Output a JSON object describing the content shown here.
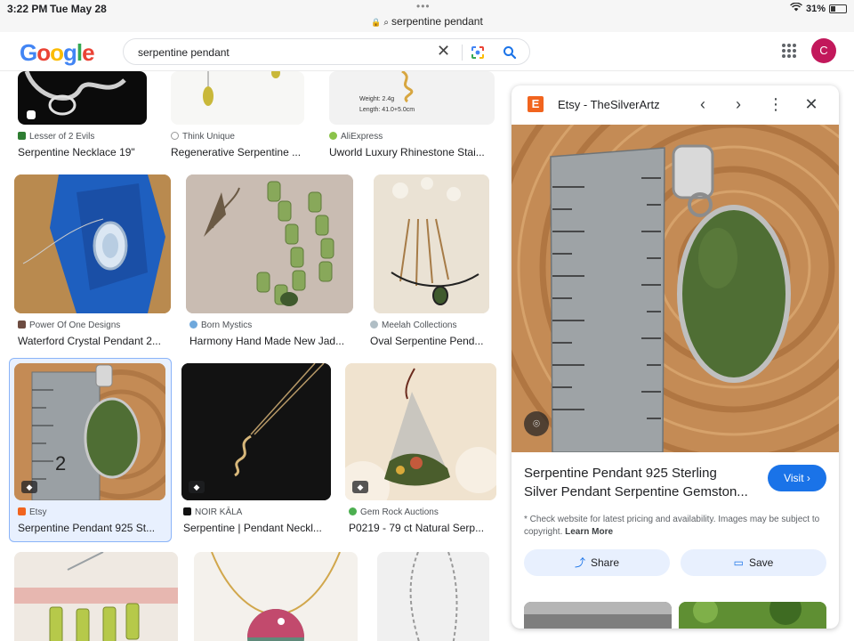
{
  "status_bar": {
    "time": "3:22 PM",
    "date": "Tue May 28",
    "url": "serpentine pendant",
    "battery": "31%",
    "battery_level": 0.31
  },
  "header": {
    "logo": "Google",
    "search_query": "serpentine pendant",
    "avatar_letter": "C"
  },
  "results": [
    {
      "source": "Lesser of 2 Evils",
      "title": "Serpentine Necklace 19\""
    },
    {
      "source": "Think Unique",
      "title": "Regenerative Serpentine ..."
    },
    {
      "source": "AliExpress",
      "title": "Uworld Luxury Rhinestone Stai...",
      "image_text": [
        "Weight: 2.4g",
        "Length: 41.0+5.0cm"
      ]
    },
    {
      "source": "Power Of One Designs",
      "title": "Waterford Crystal Pendant 2..."
    },
    {
      "source": "Born Mystics",
      "title": "Harmony Hand Made New Jad..."
    },
    {
      "source": "Meelah Collections",
      "title": "Oval Serpentine Pend..."
    },
    {
      "source": "Etsy",
      "title": "Serpentine Pendant 925 St..."
    },
    {
      "source": "NOIR KĀLA",
      "title": "Serpentine | Pendant Neckl..."
    },
    {
      "source": "Gem Rock Auctions",
      "title": "P0219 - 79 ct Natural Serp..."
    },
    {
      "source": "",
      "title": ""
    },
    {
      "source": "",
      "title": ""
    },
    {
      "source": "",
      "title": ""
    }
  ],
  "panel": {
    "site": "Etsy - TheSilverArtz",
    "title_line1": "Serpentine Pendant 925 Sterling",
    "title_line2": "Silver Pendant Serpentine Gemston...",
    "visit": "Visit",
    "note": "* Check website for latest pricing and availability. Images may be subject to copyright.",
    "learn_more": "Learn More",
    "share": "Share",
    "save": "Save"
  },
  "colors": {
    "accent": "#1a73e8",
    "etsy": "#f1641e",
    "avatar": "#c2185b",
    "stone_green": "#4f6e34"
  }
}
